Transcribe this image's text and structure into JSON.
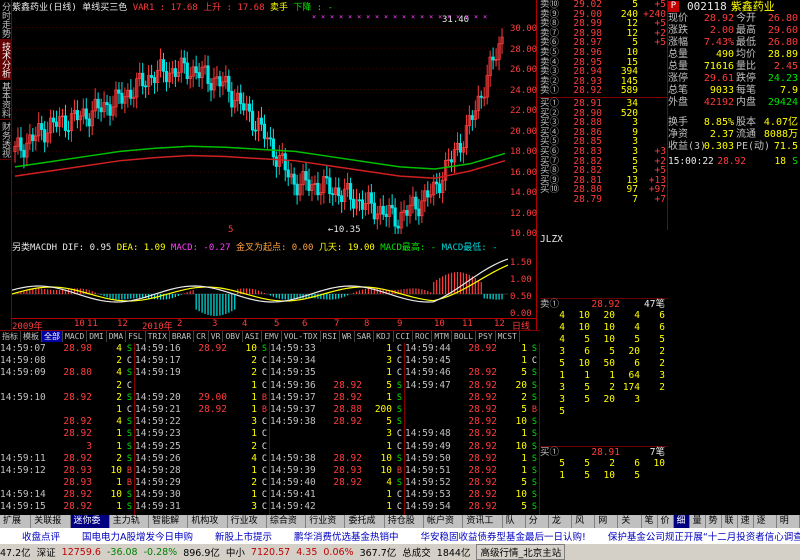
{
  "stock": {
    "code": "002118",
    "name": "紫鑫药业",
    "badge": "P"
  },
  "left_tabs": [
    "分时走势",
    "技术分析",
    "基本资料",
    "财务透视"
  ],
  "kline_title": {
    "name": "紫鑫药业(日线)",
    "mode": "单线买三色",
    "var1": "VAR1 : 17.68",
    "up": "上升 : 17.68",
    "sell": "卖手",
    "down": "下降 : -"
  },
  "kline_annot": {
    "high": "31.40",
    "low": "10.35",
    "mark": "5"
  },
  "macd_title": {
    "name": "另类MACDH",
    "dif": "DIF: 0.95",
    "dea": "DEA: 1.09",
    "macd": "MACD: -0.27",
    "gold": "金叉为起点: 0.00",
    "days": "几天: 19.00",
    "top": "MACD最高: -",
    "bottom": "MACD最低: -"
  },
  "y_labels_price": [
    "30.00",
    "28.00",
    "26.00",
    "24.00",
    "22.00",
    "20.00",
    "18.00",
    "16.00",
    "14.00",
    "12.00",
    "10.00"
  ],
  "y_labels_macd": [
    "1.50",
    "1.00",
    "0.50",
    "0.00"
  ],
  "x_labels": [
    "2009年",
    "10",
    "11",
    "12",
    "2010年",
    "2",
    "3",
    "4",
    "5",
    "6",
    "7",
    "8",
    "9",
    "10",
    "11",
    "12",
    "日线"
  ],
  "chart_data": {
    "type": "line",
    "x": [
      "2009-10",
      "2009-11",
      "2009-12",
      "2010-01",
      "2010-02",
      "2010-03",
      "2010-04",
      "2010-05",
      "2010-06",
      "2010-07",
      "2010-08",
      "2010-09",
      "2010-10",
      "2010-11",
      "2010-12"
    ],
    "series": [
      {
        "values": [
          18.0,
          20.5,
          21.5,
          23.0,
          25.5,
          26.0,
          24.5,
          20.5,
          15.0,
          14.5,
          13.0,
          11.5,
          14.0,
          20.0,
          29.0
        ]
      },
      {
        "values": [
          16.5,
          17.0,
          17.5,
          18.0,
          18.3,
          18.5,
          18.4,
          18.2,
          18.0,
          17.5,
          17.0,
          16.5,
          16.3,
          16.8,
          17.8
        ]
      }
    ],
    "ylim": [
      10,
      31.5
    ],
    "annotations": [
      "31.40",
      "10.35"
    ]
  },
  "ind_tabs": [
    "指标",
    "模板",
    "全部",
    "MACD",
    "DMI",
    "DMA",
    "FSL",
    "TRIX",
    "BRAR",
    "CR",
    "VR",
    "OBV",
    "ASI",
    "EMV",
    "VOL-TDX",
    "RSI",
    "WR",
    "SAR",
    "KDJ",
    "CCI",
    "ROC",
    "MTM",
    "BOLL",
    "PSY",
    "MCST"
  ],
  "ticks": [
    [
      [
        "14:59:07",
        "28.98",
        "4",
        "S"
      ],
      [
        "14:59:08",
        "",
        "2",
        "C"
      ],
      [
        "14:59:09",
        "28.80",
        "4",
        "S"
      ],
      [
        "",
        "",
        "2",
        "C"
      ],
      [
        "14:59:10",
        "28.92",
        "2",
        "S"
      ],
      [
        "",
        "",
        "1",
        "C"
      ],
      [
        "",
        "28.92",
        "4",
        "S"
      ],
      [
        "",
        "28.92",
        "1",
        "S"
      ],
      [
        "",
        "3",
        "1",
        "S"
      ],
      [
        "14:59:11",
        "28.92",
        "2",
        "S"
      ],
      [
        "14:59:12",
        "28.93",
        "10",
        "B"
      ],
      [
        "",
        "28.93",
        "1",
        "B"
      ],
      [
        "14:59:14",
        "28.92",
        "10",
        "S"
      ],
      [
        "14:59:15",
        "28.92",
        "1",
        "S"
      ],
      [
        "14:59:16",
        "28.93",
        "1",
        "S"
      ]
    ],
    [
      [
        "14:59:16",
        "28.92",
        "10",
        "S"
      ],
      [
        "14:59:17",
        "",
        "2",
        "C"
      ],
      [
        "14:59:19",
        "",
        "2",
        "C"
      ],
      [
        "",
        "",
        "1",
        "C"
      ],
      [
        "14:59:20",
        "29.00",
        "1",
        "B"
      ],
      [
        "14:59:21",
        "28.92",
        "1",
        "B"
      ],
      [
        "14:59:22",
        "",
        "3",
        "C"
      ],
      [
        "14:59:23",
        "",
        "1",
        "C"
      ],
      [
        "14:59:25",
        "",
        "2",
        "C"
      ],
      [
        "14:59:26",
        "",
        "4",
        "C"
      ],
      [
        "14:59:28",
        "",
        "1",
        "C"
      ],
      [
        "14:59:29",
        "",
        "2",
        "C"
      ],
      [
        "14:59:30",
        "",
        "1",
        "C"
      ],
      [
        "14:59:31",
        "",
        "3",
        "C"
      ],
      [
        "14:59:32",
        "",
        "1",
        "C"
      ]
    ],
    [
      [
        "14:59:33",
        "",
        "1",
        "C"
      ],
      [
        "14:59:34",
        "",
        "3",
        "C"
      ],
      [
        "14:59:35",
        "",
        "1",
        "C"
      ],
      [
        "14:59:36",
        "28.92",
        "5",
        "S"
      ],
      [
        "14:59:37",
        "28.92",
        "1",
        "S"
      ],
      [
        "14:59:37",
        "28.88",
        "200",
        "S"
      ],
      [
        "14:59:38",
        "28.92",
        "5",
        "S"
      ],
      [
        "",
        "",
        "3",
        "C"
      ],
      [
        "",
        "",
        "1",
        "C"
      ],
      [
        "14:59:38",
        "28.92",
        "10",
        "S"
      ],
      [
        "14:59:39",
        "28.93",
        "10",
        "B"
      ],
      [
        "14:59:40",
        "28.92",
        "4",
        "S"
      ],
      [
        "14:59:41",
        "",
        "1",
        "C"
      ],
      [
        "14:59:42",
        "",
        "1",
        "C"
      ],
      [
        "14:59:42",
        "28.92",
        "10",
        "S"
      ]
    ],
    [
      [
        "14:59:44",
        "28.92",
        "1",
        "S"
      ],
      [
        "14:59:45",
        "",
        "1",
        "C"
      ],
      [
        "14:59:46",
        "28.92",
        "5",
        "S"
      ],
      [
        "14:59:47",
        "28.92",
        "20",
        "S"
      ],
      [
        "",
        "28.92",
        "2",
        "S"
      ],
      [
        "",
        "28.92",
        "5",
        "B"
      ],
      [
        "",
        "28.92",
        "10",
        "S"
      ],
      [
        "14:59:48",
        "28.92",
        "1",
        "S"
      ],
      [
        "14:59:49",
        "28.92",
        "10",
        "S"
      ],
      [
        "14:59:50",
        "28.92",
        "1",
        "S"
      ],
      [
        "14:59:51",
        "28.92",
        "1",
        "S"
      ],
      [
        "14:59:52",
        "28.92",
        "5",
        "S"
      ],
      [
        "14:59:53",
        "28.92",
        "10",
        "S"
      ],
      [
        "14:59:54",
        "28.92",
        "5",
        "S"
      ],
      [
        "",
        "28.92",
        "1",
        "S"
      ]
    ]
  ],
  "orderbook_sell": [
    [
      "卖⑩",
      "29.02",
      "5",
      "+5"
    ],
    [
      "卖⑨",
      "29.00",
      "240",
      "+240"
    ],
    [
      "卖⑧",
      "28.99",
      "12",
      "+5"
    ],
    [
      "卖⑦",
      "28.98",
      "12",
      "+2"
    ],
    [
      "卖⑥",
      "28.97",
      "5",
      "+5"
    ],
    [
      "卖⑤",
      "28.96",
      "10",
      ""
    ],
    [
      "卖④",
      "28.95",
      "15",
      ""
    ],
    [
      "卖③",
      "28.94",
      "394",
      ""
    ],
    [
      "卖②",
      "28.93",
      "145",
      ""
    ],
    [
      "卖①",
      "28.92",
      "589",
      ""
    ]
  ],
  "orderbook_buy": [
    [
      "买①",
      "28.91",
      "34",
      ""
    ],
    [
      "买②",
      "28.90",
      "520",
      ""
    ],
    [
      "买③",
      "28.88",
      "3",
      ""
    ],
    [
      "买④",
      "28.86",
      "9",
      ""
    ],
    [
      "买⑤",
      "28.85",
      "3",
      ""
    ],
    [
      "买⑥",
      "28.83",
      "3",
      "+3"
    ],
    [
      "买⑦",
      "28.82",
      "5",
      "+2"
    ],
    [
      "买⑧",
      "28.82",
      "5",
      "+5"
    ],
    [
      "买⑨",
      "28.81",
      "13",
      "+13"
    ],
    [
      "买⑩",
      "28.80",
      "97",
      "+97"
    ],
    [
      "",
      "28.79",
      "7",
      "+7"
    ]
  ],
  "quote": [
    [
      "现价",
      "28.92",
      "今开",
      "26.80"
    ],
    [
      "涨跌",
      "2.00",
      "最高",
      "29.60"
    ],
    [
      "涨幅",
      "7.43%",
      "最低",
      "26.80"
    ],
    [
      "总量",
      "490",
      "均价",
      "28.89"
    ],
    [
      "总量",
      "71616",
      "量比",
      "2.45"
    ],
    [
      "涨停",
      "29.61",
      "跌停",
      "24.23"
    ],
    [
      "总笔",
      "9033",
      "每笔",
      "7.9"
    ],
    [
      "外盘",
      "42192",
      "内盘",
      "29424"
    ]
  ],
  "quote2": [
    [
      "换手",
      "8.85%",
      "股本",
      "4.07亿"
    ],
    [
      "净资",
      "2.37",
      "流通",
      "8088万"
    ],
    [
      "收益(3)",
      "0.303",
      "PE(动)",
      "71.5"
    ]
  ],
  "jlzx_title": "JLZX",
  "jlzx_sell": {
    "label": "卖①",
    "price": "28.92",
    "count": "47笔"
  },
  "jlzx_grid": [
    [
      "4",
      "10",
      "20",
      "4",
      "6"
    ],
    [
      "4",
      "10",
      "10",
      "4",
      "6"
    ],
    [
      "4",
      "5",
      "10",
      "5",
      "5"
    ],
    [
      "3",
      "6",
      "5",
      "20",
      "2"
    ],
    [
      "5",
      "10",
      "50",
      "6",
      "2"
    ],
    [
      "1",
      "1",
      "1",
      "64",
      "3"
    ],
    [
      "3",
      "5",
      "2",
      "174",
      "2"
    ],
    [
      "3",
      "5",
      "20",
      "3",
      ""
    ],
    [
      "5",
      "",
      "",
      "",
      ""
    ]
  ],
  "jlzx_buy": {
    "label": "买①",
    "price": "28.91",
    "count": "7笔"
  },
  "jlzx_buy_grid": [
    [
      "5",
      "5",
      "2",
      "6",
      "10"
    ],
    [
      "1",
      "5",
      "10",
      "5",
      ""
    ]
  ],
  "minute": [
    [
      "15:00:22",
      "28.92",
      "18",
      "S"
    ]
  ],
  "bottom_tabs": [
    "扩展区",
    "关联报价",
    "迷你委托",
    "主力轨迹",
    "智能解盘",
    "机构攻略",
    "行业攻略",
    "综合资讯",
    "行业资讯",
    "委托成交",
    "持仓股份",
    "帐户资金",
    "资讯工场",
    "队列",
    "分布",
    "龙虎",
    "风向",
    "网络",
    "关联",
    "笔",
    "价",
    "细",
    "量",
    "势",
    "联",
    "速",
    "逐笔",
    "明细"
  ],
  "marquee": [
    "收盘点评",
    "国电电力A股增发今日申购",
    "新股上市提示",
    "鹏华消费优选基金热销中",
    "华安稳固收益债券型基金最后一日认购!",
    "保护基金公司规正开展“十二月投资者信心调查”，欢迎您的参与"
  ],
  "status": {
    "sh": "47.2亿",
    "sz_label": "深证",
    "sz_val": "12759.6",
    "sz_chg": "-36.08",
    "sz_pct": "-0.28%",
    "sz_amt": "896.9亿",
    "zx_label": "中小",
    "zx_val": "7120.57",
    "zx_chg": "4.35",
    "zx_pct": "0.06%",
    "zx_amt": "367.7亿",
    "conn": "总成交",
    "amt": "1844亿",
    "server": "高级行情_北京主站"
  }
}
